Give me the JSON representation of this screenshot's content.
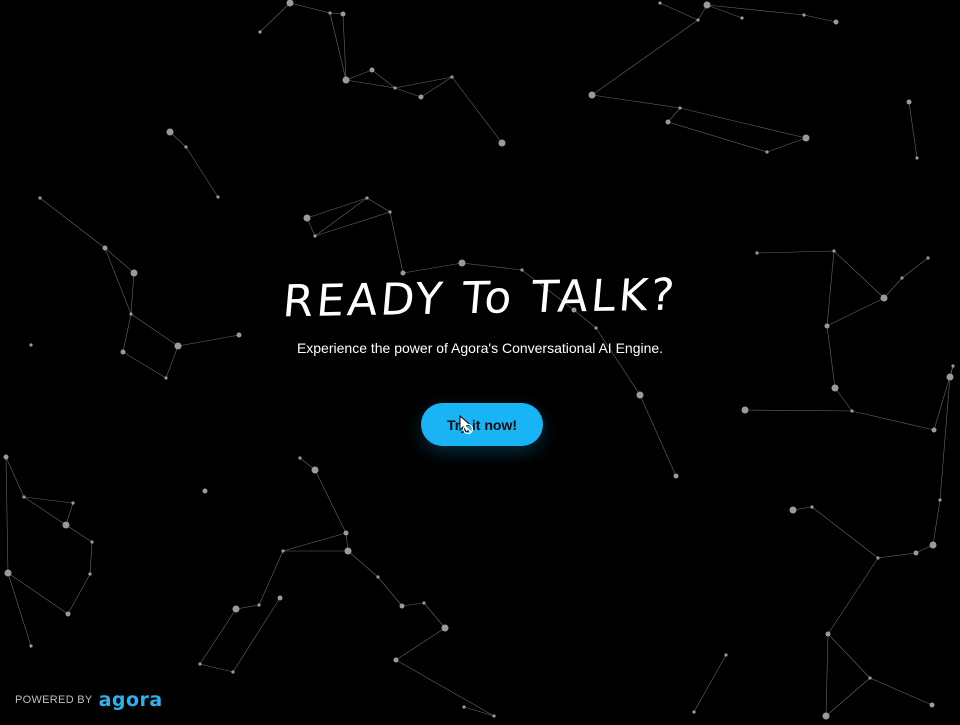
{
  "hero": {
    "title": "READY To TALK?",
    "subtitle": "Experience the power of Agora's Conversational AI Engine."
  },
  "cta": {
    "label": "Try it now!",
    "color": "#18b4f5"
  },
  "cursor": {
    "icon": "pointer-hand-icon"
  },
  "footer": {
    "powered_by": "POWERED BY",
    "brand": "agora",
    "brand_color": "#2bb3f0"
  },
  "background": {
    "color": "#000000",
    "pattern": "particle-network"
  }
}
